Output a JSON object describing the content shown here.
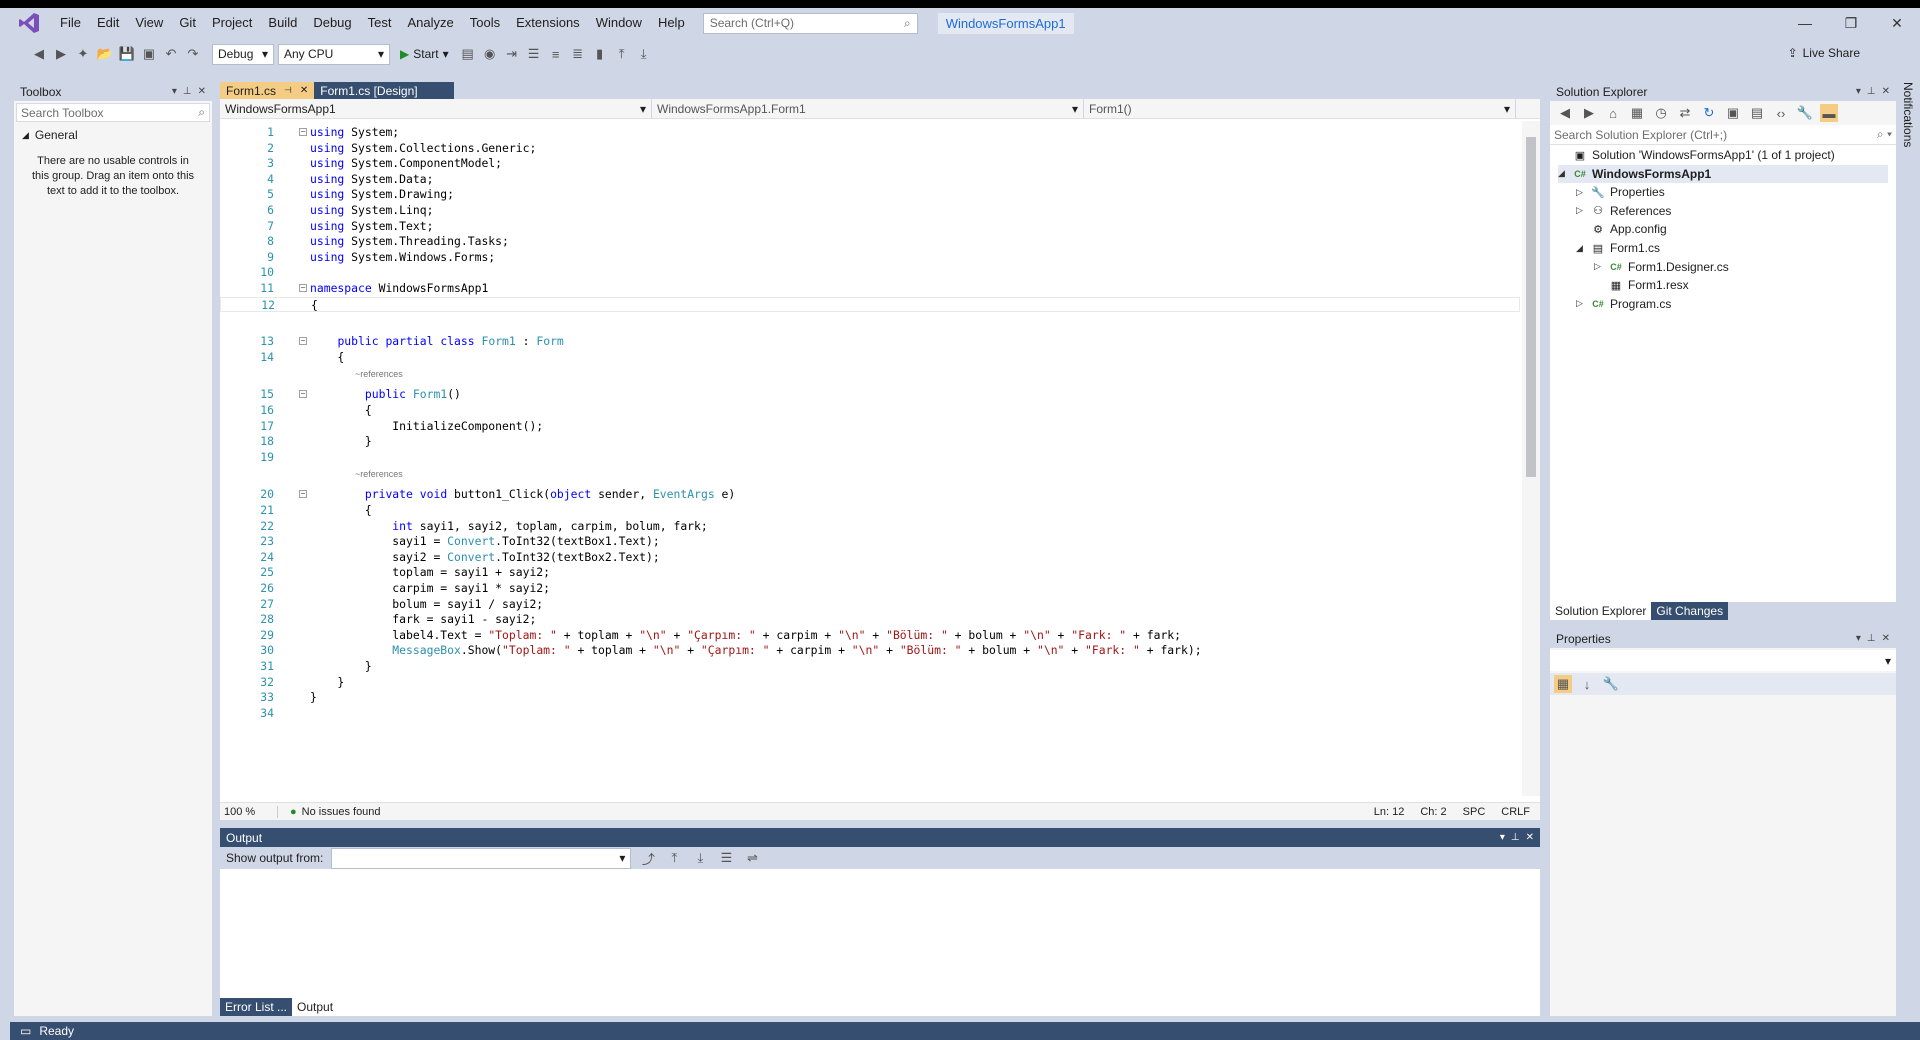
{
  "menubar": {
    "logo": "VS",
    "items": [
      "File",
      "Edit",
      "View",
      "Git",
      "Project",
      "Build",
      "Debug",
      "Test",
      "Analyze",
      "Tools",
      "Extensions",
      "Window",
      "Help"
    ],
    "search_placeholder": "Search (Ctrl+Q)",
    "solution_name": "WindowsFormsApp1"
  },
  "toolbar": {
    "config": "Debug",
    "platform": "Any CPU",
    "start_label": "Start",
    "live_share": "Live Share"
  },
  "toolbox": {
    "title": "Toolbox",
    "search_placeholder": "Search Toolbox",
    "group": "General",
    "message": "There are no usable controls in this group. Drag an item onto this text to add it to the toolbox."
  },
  "editor": {
    "tabs": [
      {
        "label": "Form1.cs",
        "active": true
      },
      {
        "label": "Form1.cs [Design]",
        "active": false
      }
    ],
    "nav": [
      "WindowsFormsApp1",
      "WindowsFormsApp1.Form1",
      "Form1()"
    ],
    "zoom": "100 %",
    "issues": "No issues found",
    "ln": "Ln: 12",
    "ch": "Ch: 2",
    "spc": "SPC",
    "crlf": "CRLF",
    "ref_hint": "~references"
  },
  "code": [
    {
      "n": "1",
      "t": "using System;"
    },
    {
      "n": "2",
      "t": "using System.Collections.Generic;"
    },
    {
      "n": "3",
      "t": "using System.ComponentModel;"
    },
    {
      "n": "4",
      "t": "using System.Data;"
    },
    {
      "n": "5",
      "t": "using System.Drawing;"
    },
    {
      "n": "6",
      "t": "using System.Linq;"
    },
    {
      "n": "7",
      "t": "using System.Text;"
    },
    {
      "n": "8",
      "t": "using System.Threading.Tasks;"
    },
    {
      "n": "9",
      "t": "using System.Windows.Forms;"
    },
    {
      "n": "10",
      "t": ""
    },
    {
      "n": "11",
      "t": "namespace WindowsFormsApp1"
    },
    {
      "n": "12",
      "t": "{"
    },
    {
      "n": "13",
      "t": "    public partial class Form1 : Form"
    },
    {
      "n": "14",
      "t": "    {"
    },
    {
      "n": "15",
      "t": "        public Form1()"
    },
    {
      "n": "16",
      "t": "        {"
    },
    {
      "n": "17",
      "t": "            InitializeComponent();"
    },
    {
      "n": "18",
      "t": "        }"
    },
    {
      "n": "19",
      "t": ""
    },
    {
      "n": "20",
      "t": "        private void button1_Click(object sender, EventArgs e)"
    },
    {
      "n": "21",
      "t": "        {"
    },
    {
      "n": "22",
      "t": "            int sayi1, sayi2, toplam, carpim, bolum, fark;"
    },
    {
      "n": "23",
      "t": "            sayi1 = Convert.ToInt32(textBox1.Text);"
    },
    {
      "n": "24",
      "t": "            sayi2 = Convert.ToInt32(textBox2.Text);"
    },
    {
      "n": "25",
      "t": "            toplam = sayi1 + sayi2;"
    },
    {
      "n": "26",
      "t": "            carpim = sayi1 * sayi2;"
    },
    {
      "n": "27",
      "t": "            bolum = sayi1 / sayi2;"
    },
    {
      "n": "28",
      "t": "            fark = sayi1 - sayi2;"
    },
    {
      "n": "29",
      "t": "            label4.Text = \"Toplam: \" + toplam + \"\\n\" + \"Çarpım: \" + carpim + \"\\n\" + \"Bölüm: \" + bolum + \"\\n\" + \"Fark: \" + fark;"
    },
    {
      "n": "30",
      "t": "            MessageBox.Show(\"Toplam: \" + toplam + \"\\n\" + \"Çarpım: \" + carpim + \"\\n\" + \"Bölüm: \" + bolum + \"\\n\" + \"Fark: \" + fark);"
    },
    {
      "n": "31",
      "t": "        }"
    },
    {
      "n": "32",
      "t": "    }"
    },
    {
      "n": "33",
      "t": "}"
    },
    {
      "n": "34",
      "t": ""
    }
  ],
  "output": {
    "title": "Output",
    "show_from": "Show output from:",
    "tabs": [
      "Error List ...",
      "Output"
    ]
  },
  "solution_explorer": {
    "title": "Solution Explorer",
    "search_placeholder": "Search Solution Explorer (Ctrl+;)",
    "tree": [
      {
        "label": "Solution 'WindowsFormsApp1' (1 of 1 project)",
        "icon": "solution-icon",
        "level": 0,
        "exp": ""
      },
      {
        "label": "WindowsFormsApp1",
        "icon": "csproj-icon",
        "level": 0,
        "exp": "◢",
        "bold": true
      },
      {
        "label": "Properties",
        "icon": "wrench-icon",
        "level": 1,
        "exp": "▷"
      },
      {
        "label": "References",
        "icon": "references-icon",
        "level": 1,
        "exp": "▷"
      },
      {
        "label": "App.config",
        "icon": "config-icon",
        "level": 1,
        "exp": ""
      },
      {
        "label": "Form1.cs",
        "icon": "form-icon",
        "level": 1,
        "exp": "◢"
      },
      {
        "label": "Form1.Designer.cs",
        "icon": "cs-file-icon",
        "level": 2,
        "exp": "▷"
      },
      {
        "label": "Form1.resx",
        "icon": "resx-icon",
        "level": 2,
        "exp": ""
      },
      {
        "label": "Program.cs",
        "icon": "cs-file-icon",
        "level": 1,
        "exp": "▷"
      }
    ],
    "tabs": [
      "Solution Explorer",
      "Git Changes"
    ]
  },
  "properties": {
    "title": "Properties"
  },
  "notifications": "Notifications",
  "status": "Ready"
}
